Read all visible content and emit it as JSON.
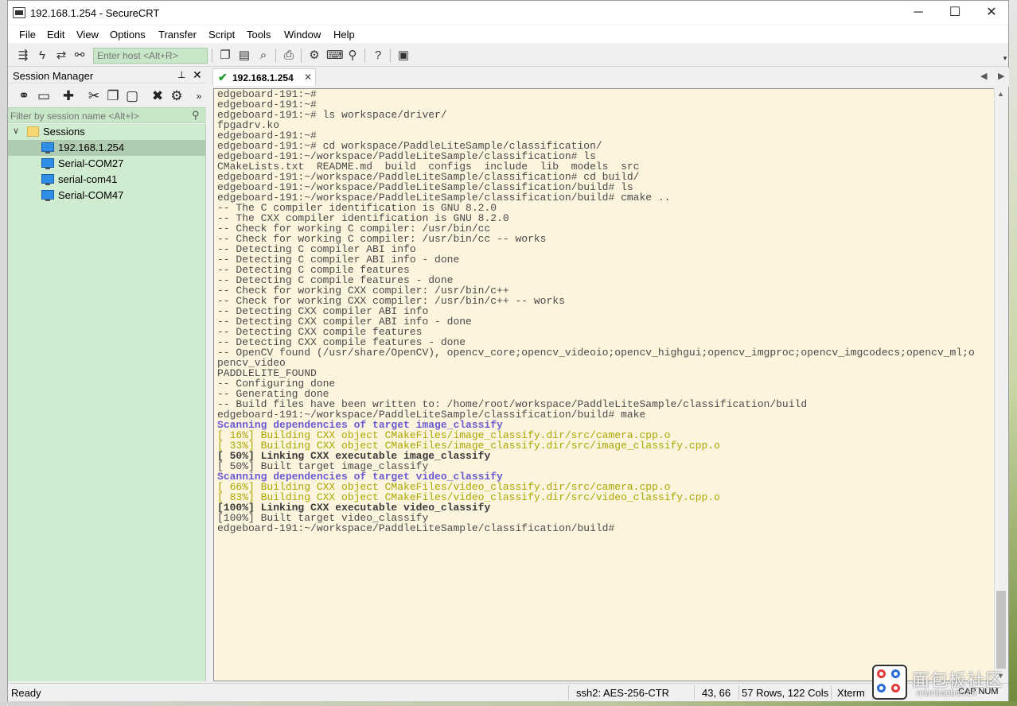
{
  "window": {
    "title": "192.168.1.254 - SecureCRT",
    "minimize_glyph": "─",
    "maximize_glyph": "☐",
    "close_glyph": "✕"
  },
  "menu": [
    {
      "label": "File"
    },
    {
      "label": "Edit"
    },
    {
      "label": "View"
    },
    {
      "label": "Options"
    },
    {
      "label": "Transfer"
    },
    {
      "label": "Script"
    },
    {
      "label": "Tools"
    },
    {
      "label": "Window"
    },
    {
      "label": "Help"
    }
  ],
  "toolbar": {
    "host_placeholder": "Enter host <Alt+R>",
    "icons": [
      "connect-icon",
      "quick-connect-icon",
      "reconnect-icon",
      "disconnect-icon",
      "copy-icon",
      "paste-icon",
      "find-icon",
      "print-icon",
      "settings-icon",
      "keymap-icon",
      "sftp-icon",
      "help-icon",
      "logo-icon"
    ]
  },
  "session_manager": {
    "title": "Session Manager",
    "pin_glyph": "⊥",
    "close_glyph": "✕",
    "filter_placeholder": "Filter by session name <Alt+I>",
    "tree": {
      "folder": "Sessions",
      "items": [
        {
          "label": "192.168.1.254",
          "selected": true
        },
        {
          "label": "Serial-COM27",
          "selected": false
        },
        {
          "label": "serial-com41",
          "selected": false
        },
        {
          "label": "Serial-COM47",
          "selected": false
        }
      ]
    }
  },
  "tabs": [
    {
      "label": "192.168.1.254",
      "close": "✕"
    }
  ],
  "terminal": {
    "lines": [
      {
        "text": "edgeboard-191:~#",
        "style": "normal"
      },
      {
        "text": "edgeboard-191:~#",
        "style": "normal"
      },
      {
        "text": "edgeboard-191:~# ls workspace/driver/",
        "style": "normal"
      },
      {
        "text": "fpgadrv.ko",
        "style": "normal"
      },
      {
        "text": "edgeboard-191:~#",
        "style": "normal"
      },
      {
        "text": "edgeboard-191:~# cd workspace/PaddleLiteSample/classification/",
        "style": "normal"
      },
      {
        "text": "edgeboard-191:~/workspace/PaddleLiteSample/classification# ls",
        "style": "normal"
      },
      {
        "text": "CMakeLists.txt  README.md  build  configs  include  lib  models  src",
        "style": "normal"
      },
      {
        "text": "edgeboard-191:~/workspace/PaddleLiteSample/classification# cd build/",
        "style": "normal"
      },
      {
        "text": "edgeboard-191:~/workspace/PaddleLiteSample/classification/build# ls",
        "style": "normal"
      },
      {
        "text": "edgeboard-191:~/workspace/PaddleLiteSample/classification/build# cmake ..",
        "style": "normal"
      },
      {
        "text": "-- The C compiler identification is GNU 8.2.0",
        "style": "normal"
      },
      {
        "text": "-- The CXX compiler identification is GNU 8.2.0",
        "style": "normal"
      },
      {
        "text": "-- Check for working C compiler: /usr/bin/cc",
        "style": "normal"
      },
      {
        "text": "-- Check for working C compiler: /usr/bin/cc -- works",
        "style": "normal"
      },
      {
        "text": "-- Detecting C compiler ABI info",
        "style": "normal"
      },
      {
        "text": "-- Detecting C compiler ABI info - done",
        "style": "normal"
      },
      {
        "text": "-- Detecting C compile features",
        "style": "normal"
      },
      {
        "text": "-- Detecting C compile features - done",
        "style": "normal"
      },
      {
        "text": "-- Check for working CXX compiler: /usr/bin/c++",
        "style": "normal"
      },
      {
        "text": "-- Check for working CXX compiler: /usr/bin/c++ -- works",
        "style": "normal"
      },
      {
        "text": "-- Detecting CXX compiler ABI info",
        "style": "normal"
      },
      {
        "text": "-- Detecting CXX compiler ABI info - done",
        "style": "normal"
      },
      {
        "text": "-- Detecting CXX compile features",
        "style": "normal"
      },
      {
        "text": "-- Detecting CXX compile features - done",
        "style": "normal"
      },
      {
        "text": "-- OpenCV found (/usr/share/OpenCV), opencv_core;opencv_videoio;opencv_highgui;opencv_imgproc;opencv_imgcodecs;opencv_ml;o",
        "style": "normal"
      },
      {
        "text": "pencv_video",
        "style": "normal"
      },
      {
        "text": "PADDLELITE_FOUND",
        "style": "normal"
      },
      {
        "text": "-- Configuring done",
        "style": "normal"
      },
      {
        "text": "-- Generating done",
        "style": "normal"
      },
      {
        "text": "-- Build files have been written to: /home/root/workspace/PaddleLiteSample/classification/build",
        "style": "normal"
      },
      {
        "text": "edgeboard-191:~/workspace/PaddleLiteSample/classification/build# make",
        "style": "normal"
      },
      {
        "text": "Scanning dependencies of target image_classify",
        "style": "scan"
      },
      {
        "text": "[ 16%] Building CXX object CMakeFiles/image_classify.dir/src/camera.cpp.o",
        "style": "build"
      },
      {
        "text": "[ 33%] Building CXX object CMakeFiles/image_classify.dir/src/image_classify.cpp.o",
        "style": "build"
      },
      {
        "text": "[ 50%] Linking CXX executable image_classify",
        "style": "link"
      },
      {
        "text": "[ 50%] Built target image_classify",
        "style": "normal"
      },
      {
        "text": "Scanning dependencies of target video_classify",
        "style": "scan"
      },
      {
        "text": "[ 66%] Building CXX object CMakeFiles/video_classify.dir/src/camera.cpp.o",
        "style": "build"
      },
      {
        "text": "[ 83%] Building CXX object CMakeFiles/video_classify.dir/src/video_classify.cpp.o",
        "style": "build"
      },
      {
        "text": "[100%] Linking CXX executable video_classify",
        "style": "link"
      },
      {
        "text": "[100%] Built target video_classify",
        "style": "normal"
      },
      {
        "text": "edgeboard-191:~/workspace/PaddleLiteSample/classification/build#",
        "style": "normal"
      }
    ]
  },
  "status": {
    "ready": "Ready",
    "encryption": "ssh2: AES-256-CTR",
    "cursor": "43,  66",
    "size": "57 Rows, 122 Cols",
    "terminal_type": "Xterm",
    "caps": "CAP NUM"
  },
  "watermark": {
    "text": "面包板社区",
    "url": "mianbaoban.cn"
  },
  "colors": {
    "terminal_bg": "#fdf4de",
    "session_tree_bg": "#d0ecd0",
    "host_input_bg": "#c8e6c8",
    "scan_text": "#6a5bd4",
    "build_text": "#a8a800"
  }
}
